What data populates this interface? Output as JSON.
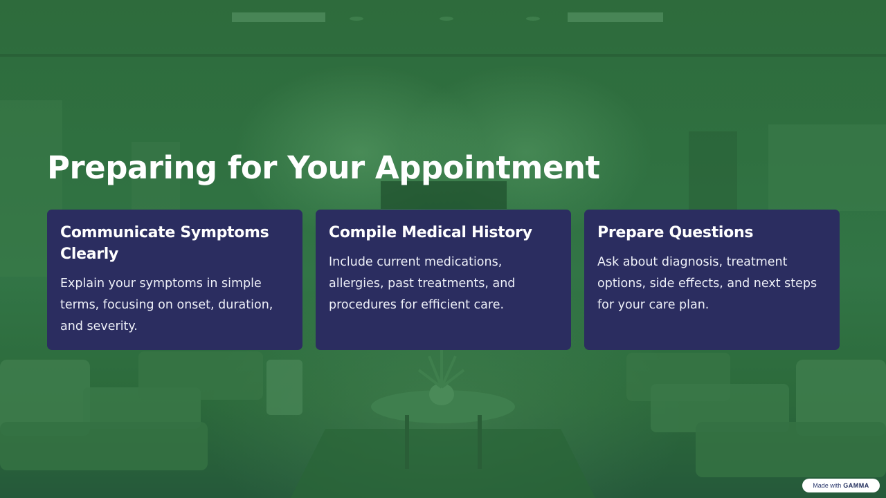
{
  "slide": {
    "title": "Preparing for Your Appointment"
  },
  "cards": [
    {
      "title": "Communicate Symptoms Clearly",
      "text": "Explain your symptoms in simple terms, focusing on onset, duration, and severity."
    },
    {
      "title": "Compile Medical History",
      "text": "Include current medications, allergies, past treatments, and procedures for efficient care."
    },
    {
      "title": "Prepare Questions",
      "text": "Ask about diagnosis, treatment options, side effects, and next steps for your care plan."
    }
  ],
  "badge": {
    "prefix": "Made with",
    "brand": "GAMMA"
  },
  "colors": {
    "background_tint": "#2f7040",
    "card_background": "#2b2d60",
    "title_text": "#ffffff"
  }
}
